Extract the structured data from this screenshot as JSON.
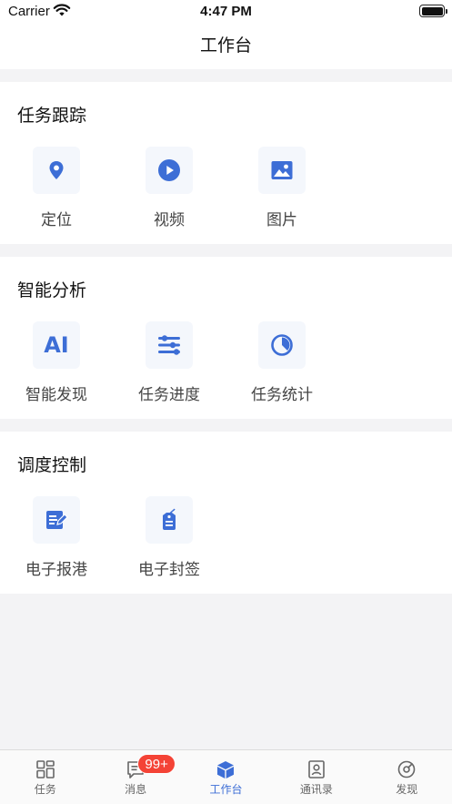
{
  "status_bar": {
    "carrier": "Carrier",
    "time": "4:47 PM"
  },
  "nav": {
    "title": "工作台"
  },
  "sections": [
    {
      "title": "任务跟踪",
      "items": [
        {
          "label": "定位",
          "icon": "location-pin-icon"
        },
        {
          "label": "视频",
          "icon": "play-video-icon"
        },
        {
          "label": "图片",
          "icon": "image-icon"
        }
      ]
    },
    {
      "title": "智能分析",
      "items": [
        {
          "label": "智能发现",
          "icon": "ai-icon",
          "icon_text": "AI"
        },
        {
          "label": "任务进度",
          "icon": "sliders-icon"
        },
        {
          "label": "任务统计",
          "icon": "pie-chart-icon"
        }
      ]
    },
    {
      "title": "调度控制",
      "items": [
        {
          "label": "电子报港",
          "icon": "edit-document-icon"
        },
        {
          "label": "电子封签",
          "icon": "seal-tag-icon"
        }
      ]
    }
  ],
  "tabbar": {
    "tabs": [
      {
        "label": "任务",
        "icon": "grid-icon"
      },
      {
        "label": "消息",
        "icon": "message-icon",
        "badge": "99+"
      },
      {
        "label": "工作台",
        "icon": "cube-icon",
        "active": true
      },
      {
        "label": "通讯录",
        "icon": "contacts-icon"
      },
      {
        "label": "发现",
        "icon": "compass-icon"
      }
    ]
  },
  "colors": {
    "accent": "#3d6ed6",
    "icon_bg": "#f4f7fc",
    "badge": "#f44336",
    "page_bg": "#f3f3f5"
  }
}
